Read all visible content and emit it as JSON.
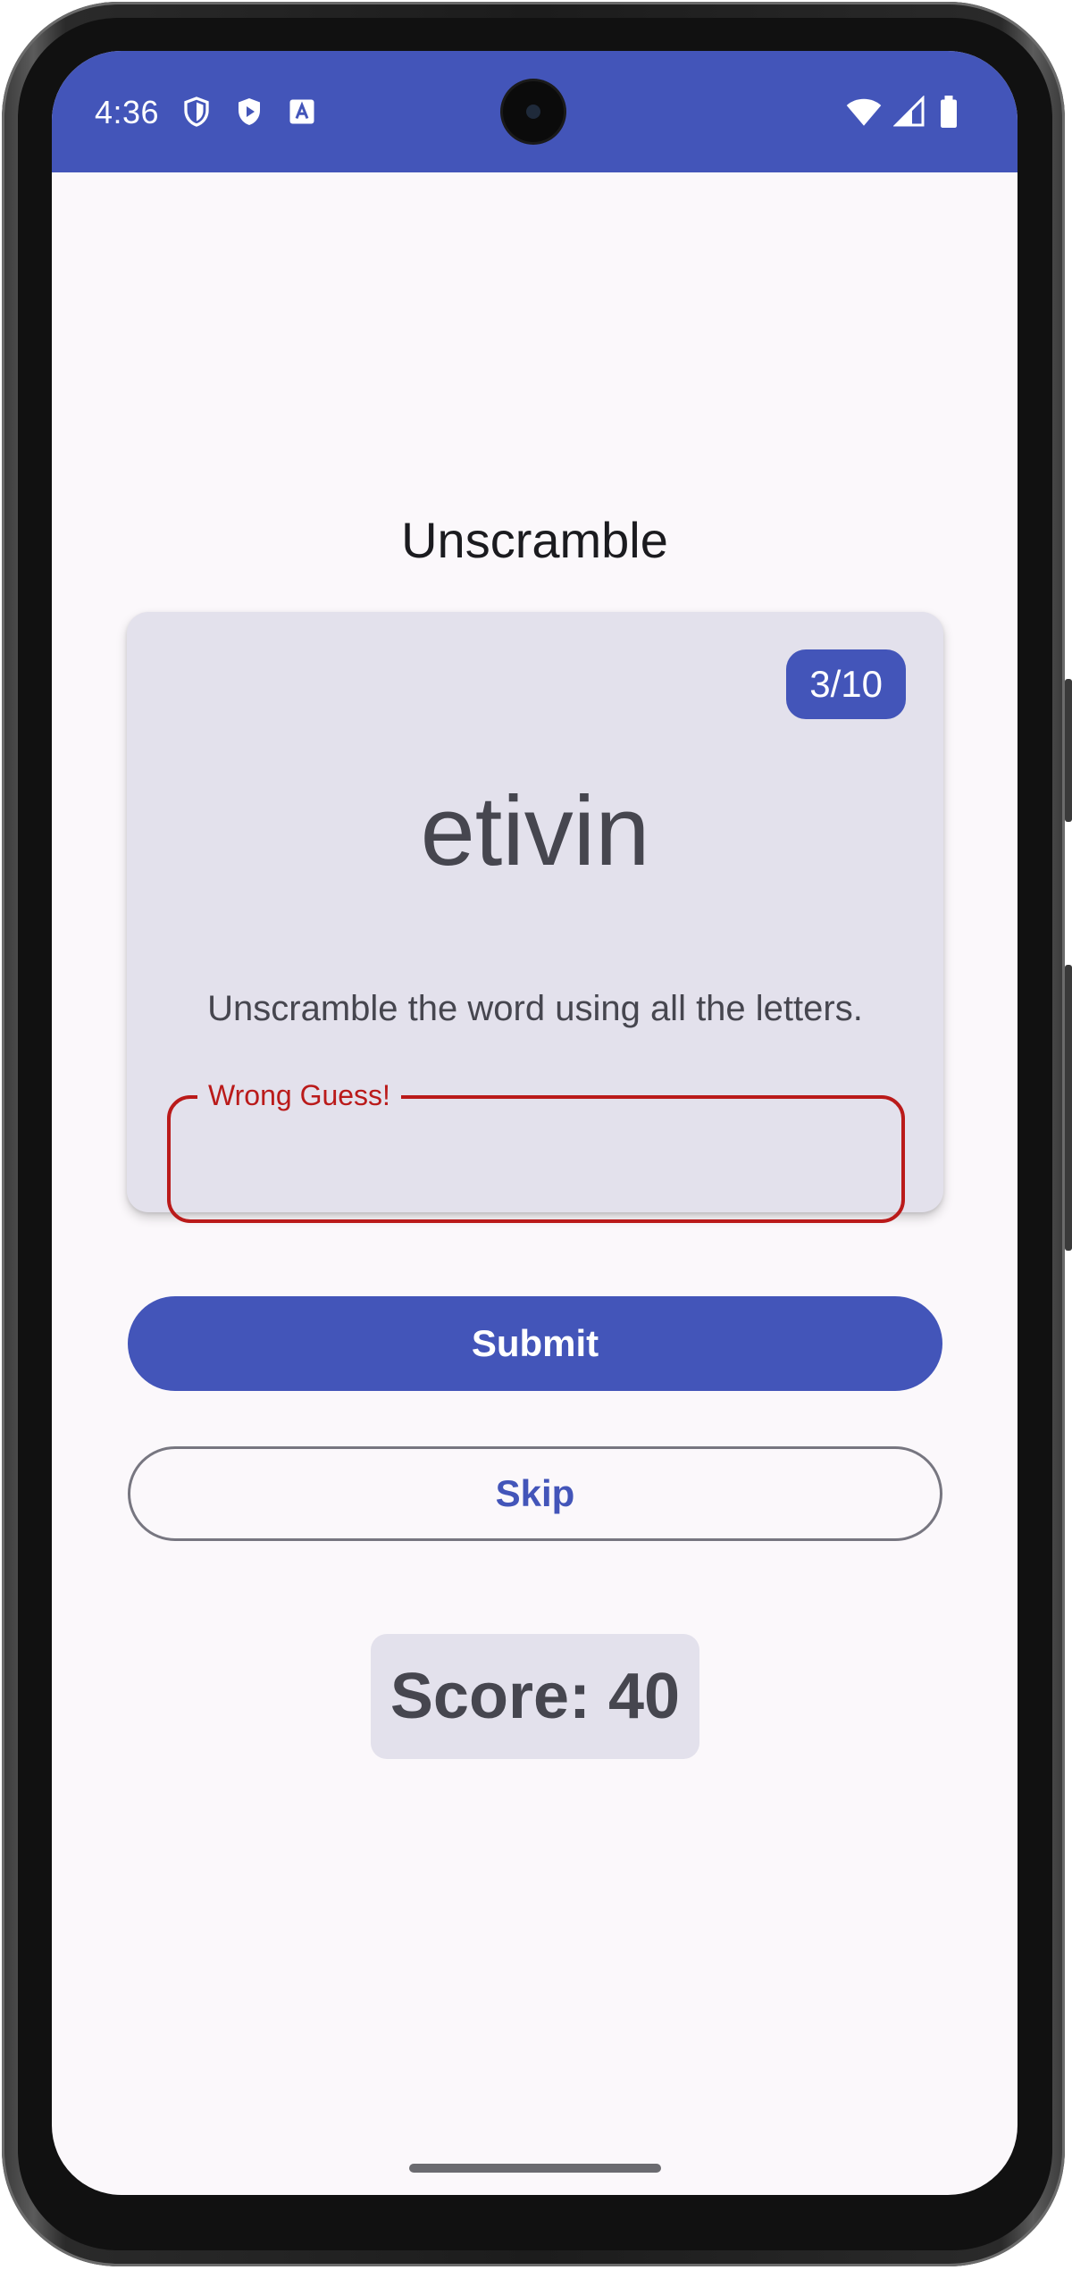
{
  "status_bar": {
    "time": "4:36",
    "left_icons": [
      "shield-icon",
      "play-protect-icon",
      "accessibility-a-icon"
    ],
    "right_icons": [
      "wifi-icon",
      "cellular-signal-icon",
      "battery-icon"
    ]
  },
  "app": {
    "title": "Unscramble"
  },
  "game_card": {
    "word_count": "3/10",
    "scrambled_word": "etivin",
    "instructions": "Unscramble the word using all the letters.",
    "input": {
      "label": "Wrong Guess!",
      "value": "",
      "error": true
    }
  },
  "actions": {
    "submit_label": "Submit",
    "skip_label": "Skip"
  },
  "score": {
    "text": "Score: 40"
  },
  "colors": {
    "primary": "#4355b9",
    "error": "#ba1a1a",
    "surface_variant": "#e3e1ec",
    "on_surface_variant": "#46464f",
    "background": "#fbf8fb"
  }
}
